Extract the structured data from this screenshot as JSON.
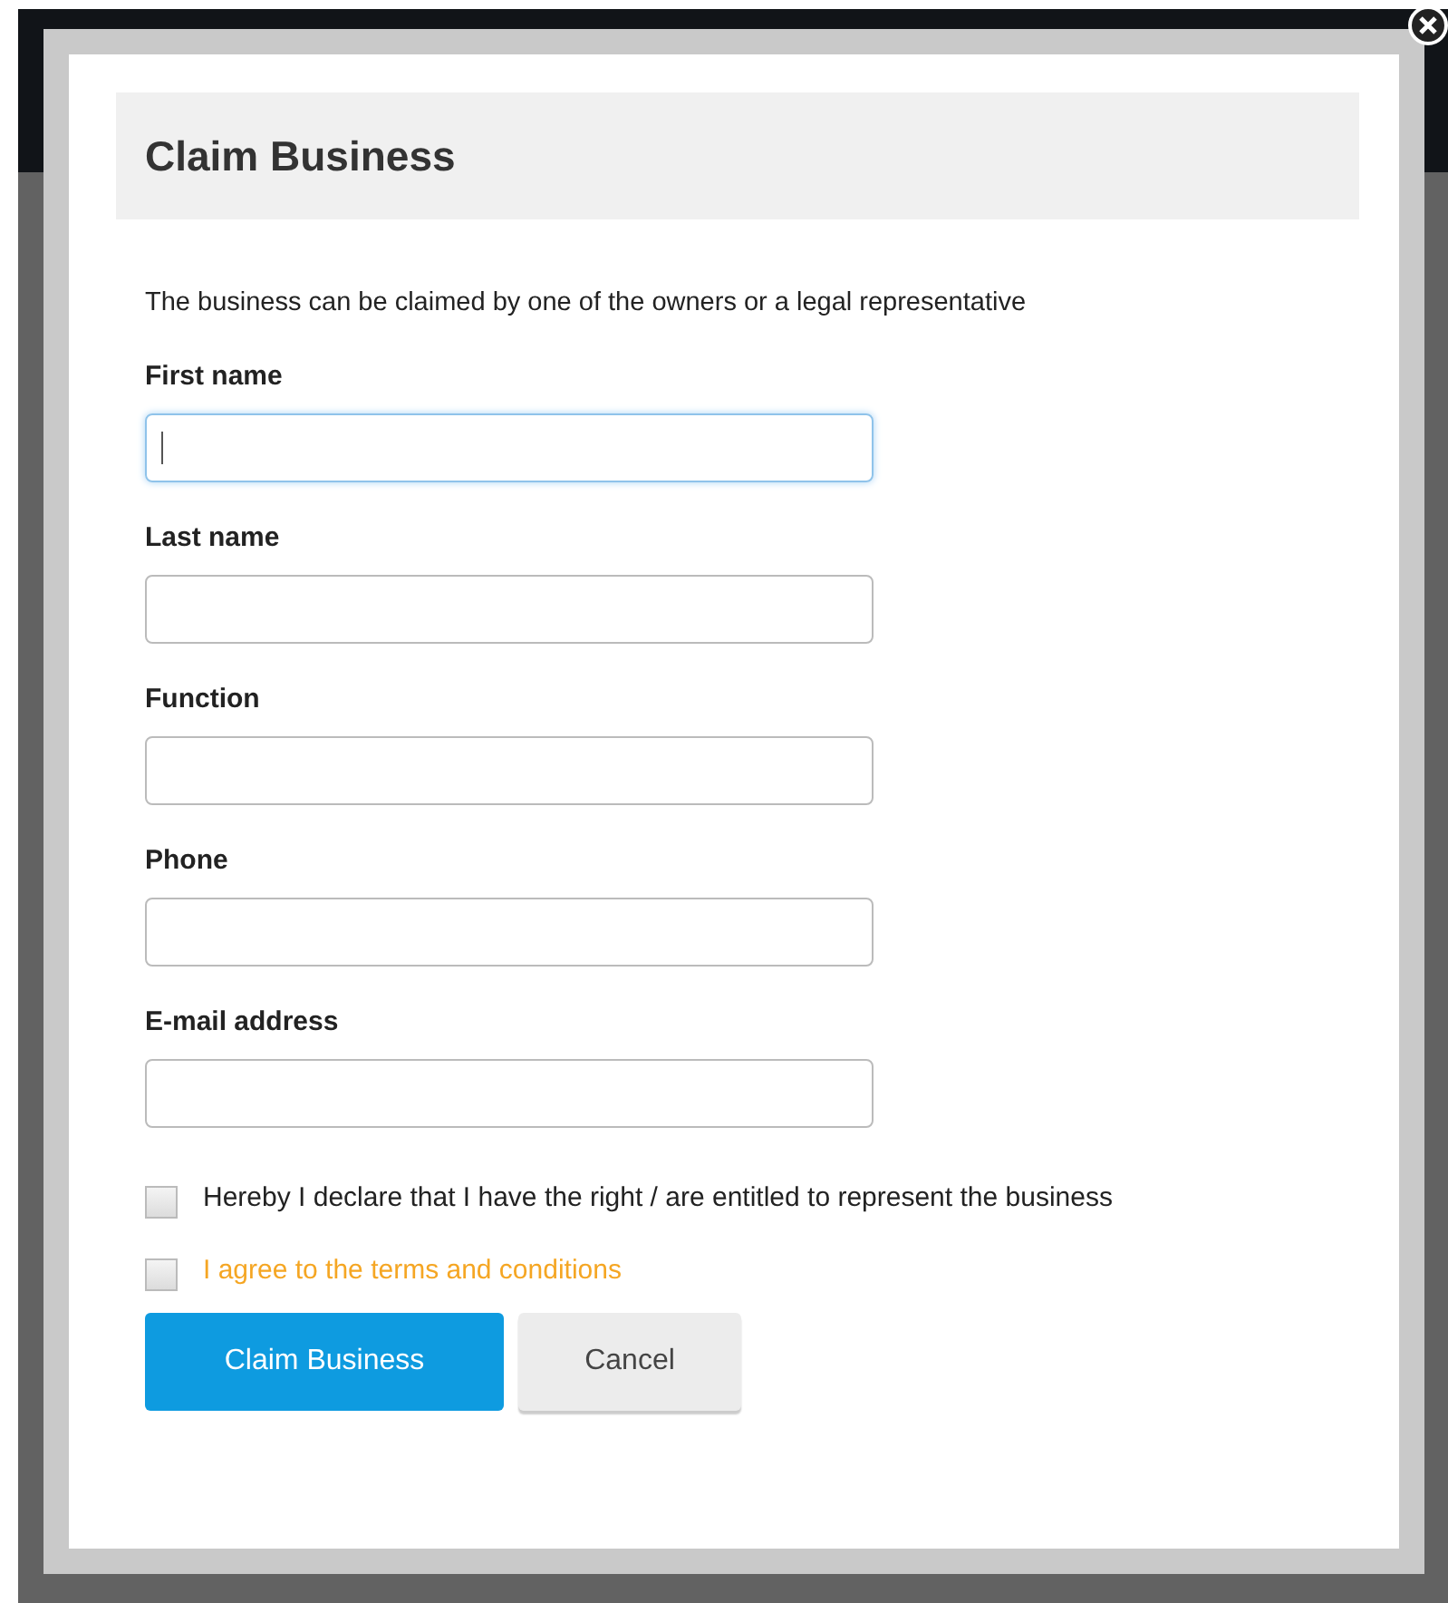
{
  "dialog": {
    "title": "Claim Business",
    "intro": "The business can be claimed by one of the owners or a legal representative",
    "fields": [
      {
        "label": "First name",
        "focused": true
      },
      {
        "label": "Last name",
        "focused": false
      },
      {
        "label": "Function",
        "focused": false
      },
      {
        "label": "Phone",
        "focused": false
      },
      {
        "label": "E-mail address",
        "focused": false
      }
    ],
    "checkboxes": [
      {
        "label": "Hereby I declare that I have the right / are entitled to represent the business",
        "checked": false,
        "kind": "plain"
      },
      {
        "label": "I agree to the terms and conditions",
        "checked": false,
        "kind": "link"
      }
    ],
    "buttons": [
      {
        "label": "Claim Business",
        "kind": "primary"
      },
      {
        "label": "Cancel",
        "kind": "secondary"
      }
    ]
  }
}
